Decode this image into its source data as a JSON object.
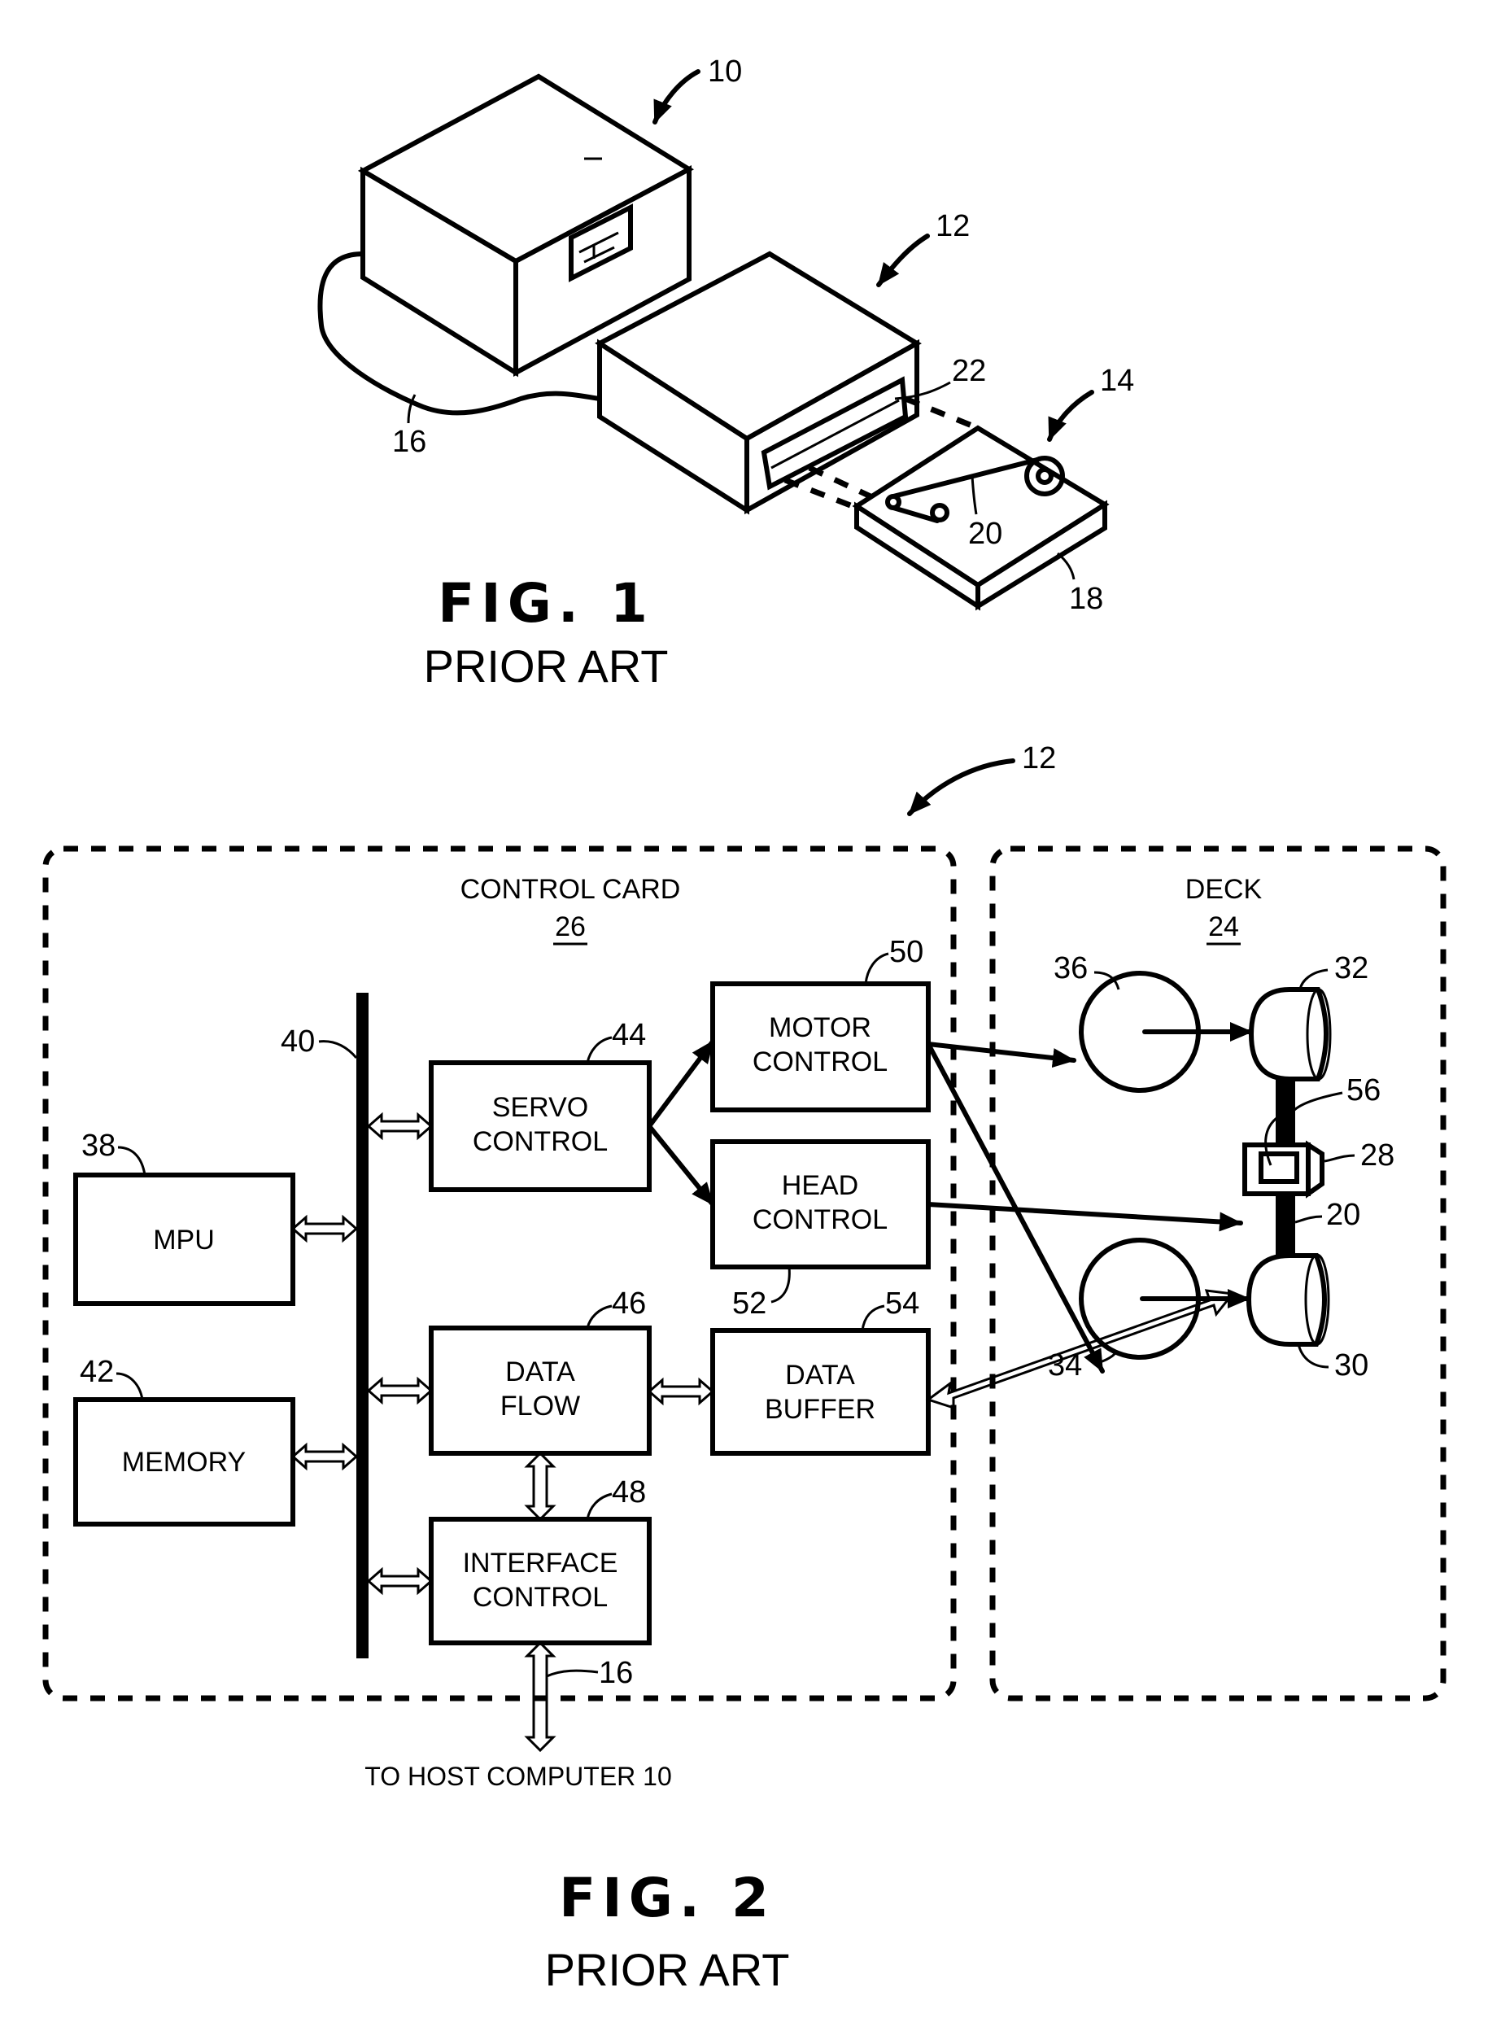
{
  "fig1": {
    "caption": "FIG. 1",
    "subcaption": "PRIOR ART",
    "refs": {
      "host_computer": "10",
      "tape_drive": "12",
      "cartridge": "14",
      "cable": "16",
      "cartridge_housing": "18",
      "tape": "20",
      "slot": "22"
    }
  },
  "fig2": {
    "caption": "FIG. 2",
    "subcaption": "PRIOR ART",
    "drive_ref": "12",
    "control_card": {
      "title": "CONTROL CARD",
      "ref": "26"
    },
    "deck": {
      "title": "DECK",
      "ref": "24"
    },
    "bus_ref": "40",
    "blocks": {
      "mpu": {
        "line1": "MPU",
        "line2": "",
        "ref": "38"
      },
      "memory": {
        "line1": "MEMORY",
        "line2": "",
        "ref": "42"
      },
      "servo": {
        "line1": "SERVO",
        "line2": "CONTROL",
        "ref": "44"
      },
      "motor": {
        "line1": "MOTOR",
        "line2": "CONTROL",
        "ref": "50"
      },
      "head": {
        "line1": "HEAD",
        "line2": "CONTROL",
        "ref": "52"
      },
      "dataflow": {
        "line1": "DATA",
        "line2": "FLOW",
        "ref": "46"
      },
      "buffer": {
        "line1": "DATA",
        "line2": "BUFFER",
        "ref": "54"
      },
      "interface": {
        "line1": "INTERFACE",
        "line2": "CONTROL",
        "ref": "48"
      }
    },
    "host_link_ref": "16",
    "host_label": "TO HOST COMPUTER 10",
    "deck_refs": {
      "motor_upper": "36",
      "reel_upper": "32",
      "motor_lower": "34",
      "reel_lower": "30",
      "head": "28",
      "gap": "56",
      "tape": "20"
    }
  }
}
